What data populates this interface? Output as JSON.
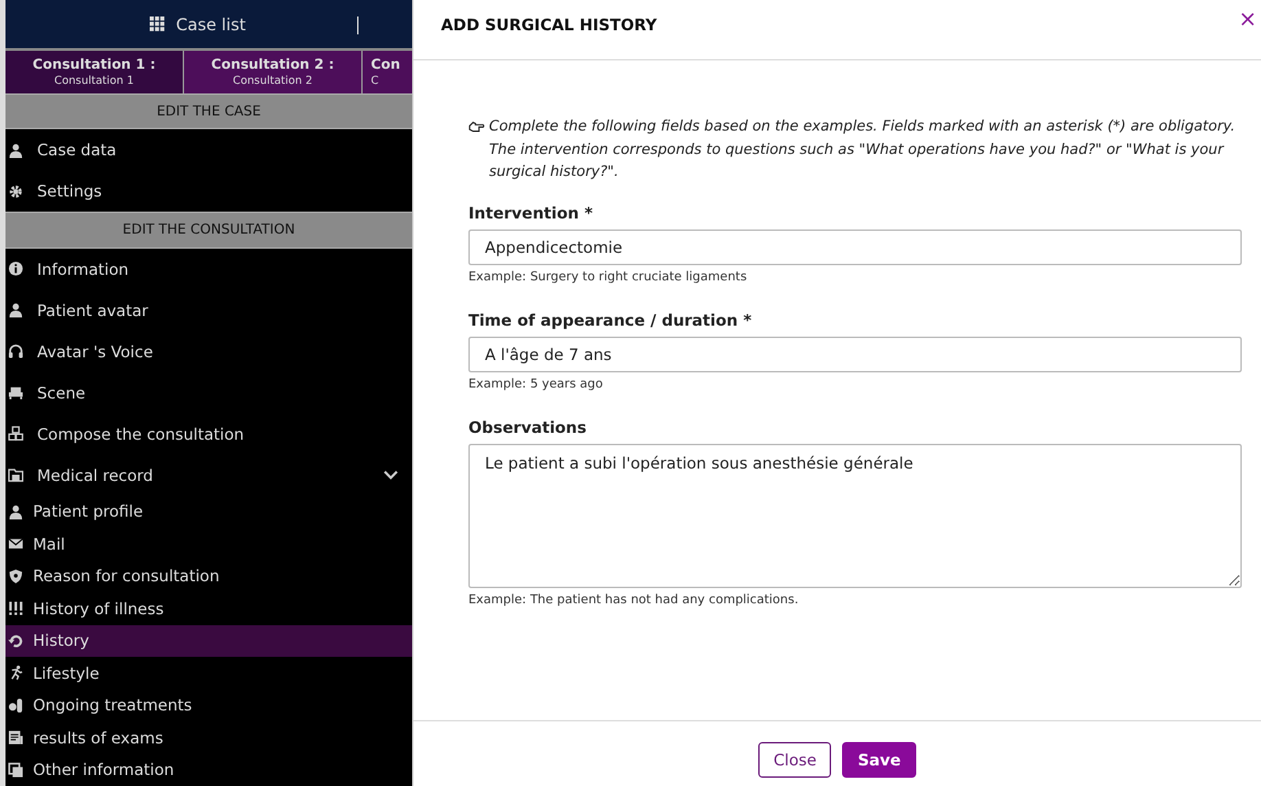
{
  "sidebar": {
    "case_list": "Case list",
    "consultation_tabs": [
      {
        "title": "Consultation 1 :",
        "subtitle": "Consultation 1",
        "selected": true
      },
      {
        "title": "Consultation 2 :",
        "subtitle": "Consultation 2",
        "selected": false
      },
      {
        "title": "Con",
        "subtitle": "C",
        "selected": false
      }
    ],
    "case_section": "EDIT THE CASE",
    "case_items": [
      {
        "label": "Case data",
        "selected": false
      },
      {
        "label": "Settings",
        "selected": false
      }
    ],
    "consultation_section": "EDIT THE CONSULTATION",
    "consultation_items": [
      {
        "label": "Information",
        "selected": false
      },
      {
        "label": "Patient avatar",
        "selected": false
      },
      {
        "label": "Avatar 's Voice",
        "selected": false
      },
      {
        "label": "Scene",
        "selected": false
      },
      {
        "label": "Compose the consultation",
        "selected": false
      },
      {
        "label": "Medical record",
        "selected": false,
        "expanded": true,
        "children": [
          {
            "label": "Patient profile",
            "selected": false
          },
          {
            "label": "Mail",
            "selected": false
          },
          {
            "label": "Reason for consultation",
            "selected": false
          },
          {
            "label": "History of illness",
            "selected": false
          },
          {
            "label": "History",
            "selected": true
          },
          {
            "label": "Lifestyle",
            "selected": false
          },
          {
            "label": "Ongoing treatments",
            "selected": false
          },
          {
            "label": "results of exams",
            "selected": false
          },
          {
            "label": "Other information",
            "selected": false
          }
        ]
      }
    ]
  },
  "dialog": {
    "title": "ADD SURGICAL HISTORY",
    "close": "×",
    "instructions": "Complete the following fields based on the examples. Fields marked with an asterisk (*) are obligatory. The intervention corresponds to questions such as \"What operations have you had?\" or \"What is your surgical history?\".",
    "fields": [
      {
        "kind": "input",
        "label": "Intervention *",
        "value": "Appendicectomie",
        "example": "Example: Surgery to right cruciate ligaments"
      },
      {
        "kind": "input",
        "label": "Time of appearance / duration *",
        "value": "A l'âge de 7 ans",
        "example": "Example: 5 years ago"
      },
      {
        "kind": "textarea",
        "label": "Observations",
        "value": "Le patient a subi l'opération sous anesthésie générale",
        "example": "Example: The patient has not had any complications."
      }
    ],
    "buttons": [
      {
        "label": "Close",
        "kind": "secondary"
      },
      {
        "label": "Save",
        "kind": "primary"
      }
    ]
  }
}
